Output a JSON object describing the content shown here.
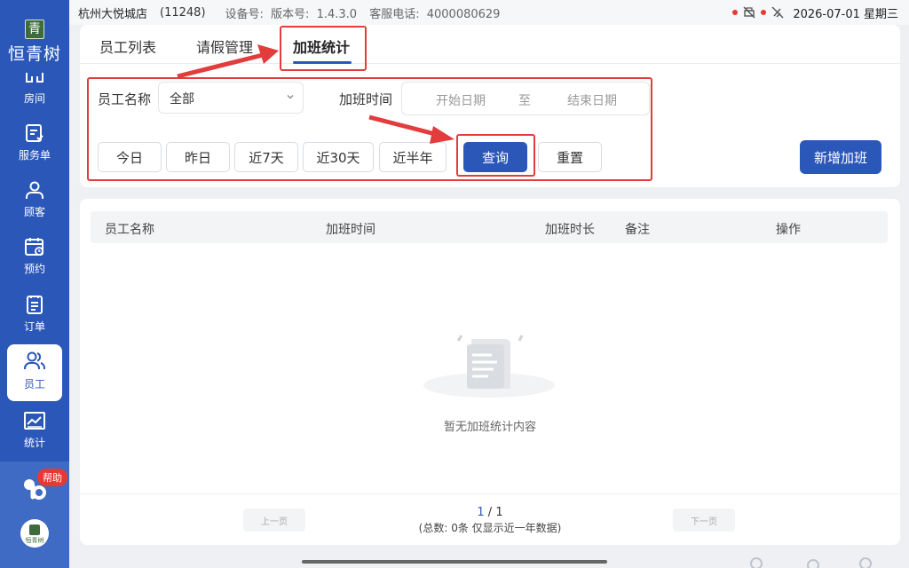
{
  "statusbar": {
    "store_name": "杭州大悦城店",
    "store_code": "(11248)",
    "device_label": "设备号:",
    "version_label": "版本号:",
    "version": "1.4.3.0",
    "hotline_label": "客服电话:",
    "hotline": "4000080629",
    "datetime": "2026-07-01 星期三"
  },
  "sidebar": {
    "brand": "恒青树",
    "logo_char": "青",
    "items": [
      {
        "label": "房间",
        "icon": "room-icon"
      },
      {
        "label": "服务单",
        "icon": "service-order-icon"
      },
      {
        "label": "顾客",
        "icon": "customer-icon"
      },
      {
        "label": "预约",
        "icon": "calendar-icon"
      },
      {
        "label": "订单",
        "icon": "order-icon"
      },
      {
        "label": "员工",
        "icon": "staff-icon"
      },
      {
        "label": "统计",
        "icon": "stats-icon"
      }
    ],
    "active": "员工",
    "help_label": "帮助",
    "mini_brand": "恒青树"
  },
  "tabs": {
    "items": [
      "员工列表",
      "请假管理",
      "加班统计"
    ],
    "active": "加班统计"
  },
  "filters": {
    "employee_label": "员工名称",
    "employee_value": "全部",
    "time_label": "加班时间",
    "start_placeholder": "开始日期",
    "range_sep": "至",
    "end_placeholder": "结束日期",
    "quick_ranges": [
      "今日",
      "昨日",
      "近7天",
      "近30天",
      "近半年"
    ],
    "query_label": "查询",
    "reset_label": "重置",
    "add_label": "新增加班"
  },
  "table": {
    "columns": [
      "员工名称",
      "加班时间",
      "加班时长",
      "备注",
      "操作"
    ],
    "empty_text": "暂无加班统计内容"
  },
  "pagination": {
    "prev_label": "上一页",
    "next_label": "下一页",
    "current": "1",
    "separator": " / ",
    "total_pages": "1",
    "summary": "(总数: 0条 仅显示近一年数据)"
  },
  "colors": {
    "primary": "#2b58b8",
    "annotation": "#e23c3c"
  }
}
